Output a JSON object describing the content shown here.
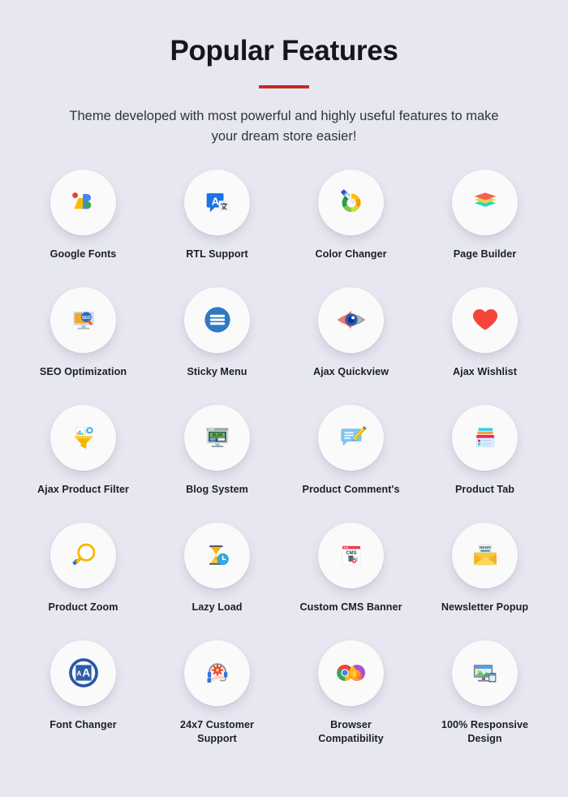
{
  "header": {
    "title": "Popular Features",
    "rule_color": "#c62828",
    "subtitle": "Theme developed with most powerful and highly useful features to make your dream store easier!"
  },
  "theme": {
    "background": "#e7e7f1",
    "circle_background": "#fafafa",
    "label_color": "#1d1f25",
    "title_color": "#15161a"
  },
  "features": [
    {
      "label": "Google Fonts",
      "icon": "google-fonts-icon"
    },
    {
      "label": "RTL Support",
      "icon": "translate-icon"
    },
    {
      "label": "Color Changer",
      "icon": "color-picker-icon"
    },
    {
      "label": "Page Builder",
      "icon": "layers-icon"
    },
    {
      "label": "SEO Optimization",
      "icon": "seo-monitor-icon"
    },
    {
      "label": "Sticky Menu",
      "icon": "hamburger-menu-icon"
    },
    {
      "label": "Ajax Quickview",
      "icon": "eye-icon"
    },
    {
      "label": "Ajax Wishlist",
      "icon": "heart-icon"
    },
    {
      "label": "Ajax Product Filter",
      "icon": "funnel-filter-icon"
    },
    {
      "label": "Blog System",
      "icon": "blog-monitor-icon"
    },
    {
      "label": "Product Comment's",
      "icon": "comment-pencil-icon"
    },
    {
      "label": "Product Tab",
      "icon": "tab-list-icon"
    },
    {
      "label": "Product Zoom",
      "icon": "magnifier-icon"
    },
    {
      "label": "Lazy Load",
      "icon": "hourglass-clock-icon"
    },
    {
      "label": "Custom CMS Banner",
      "icon": "cms-window-icon"
    },
    {
      "label": "Newsletter Popup",
      "icon": "newsletter-envelope-icon"
    },
    {
      "label": "Font Changer",
      "icon": "font-size-icon"
    },
    {
      "label": "24x7 Customer\nSupport",
      "icon": "headset-support-icon"
    },
    {
      "label": "Browser\nCompatibility",
      "icon": "browsers-icon"
    },
    {
      "label": "100% Responsive\nDesign",
      "icon": "responsive-devices-icon"
    }
  ]
}
